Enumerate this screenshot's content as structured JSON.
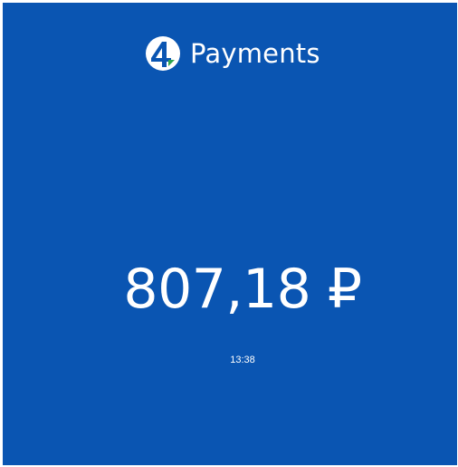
{
  "brand": {
    "icon": "4payments-logo-icon",
    "name": "Payments"
  },
  "payment": {
    "amount": "807,18 ₽",
    "time": "13:38"
  },
  "colors": {
    "background": "#0a55b2",
    "text": "#ffffff",
    "accent": "#2ea44f"
  }
}
